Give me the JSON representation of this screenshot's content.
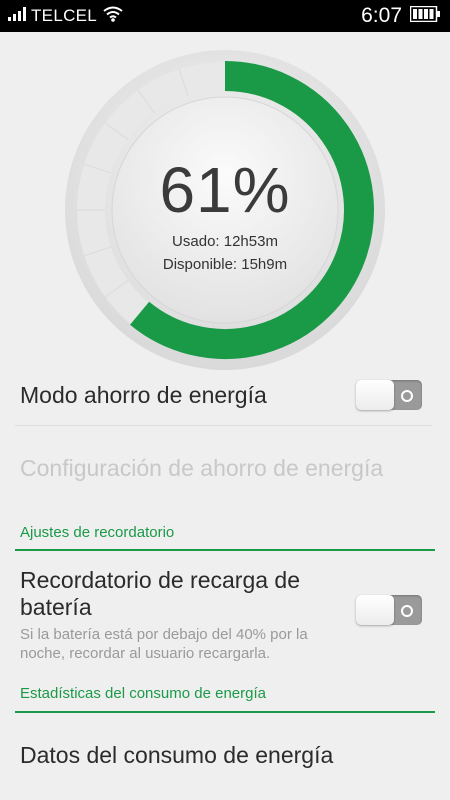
{
  "status_bar": {
    "carrier": "TELCEL",
    "time": "6:07",
    "icons": [
      "signal-icon",
      "wifi-icon",
      "battery-icon"
    ]
  },
  "battery": {
    "percent_label": "61%",
    "level": 0.61,
    "used": "Usado: 12h53m",
    "available": "Disponible: 15h9m",
    "accent_color": "#1a9a47"
  },
  "settings": {
    "power_saving_mode": {
      "label": "Modo ahorro de energía",
      "enabled": false
    },
    "power_saving_config": {
      "label": "Configuración de ahorro de energía",
      "disabled": true
    },
    "reminder_section": {
      "label": "Ajustes de recordatorio"
    },
    "recharge_reminder": {
      "label_line1": "Recordatorio de recarga de",
      "label_line2": "batería",
      "description_line1": "Si la batería está por debajo del 40% por la",
      "description_line2": "noche, recordar al usuario recargarla.",
      "enabled": false
    },
    "stats_section": {
      "label": "Estadísticas del consumo de energía"
    },
    "consumption_data": {
      "label": "Datos del consumo de energía"
    }
  }
}
